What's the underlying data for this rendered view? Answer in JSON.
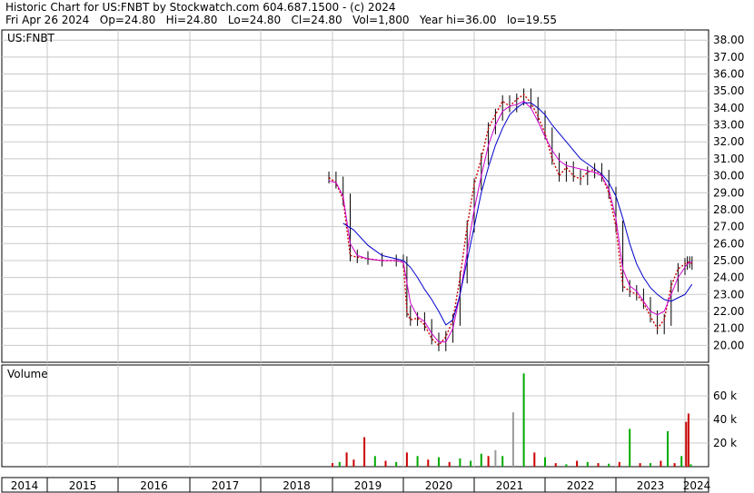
{
  "header": {
    "line1": "Historic Chart for US:FNBT by Stockwatch.com 604.687.1500 - (c) 2024",
    "line2": "Fri Apr 26 2024   Op=24.80   Hi=24.80   Lo=24.80   Cl=24.80   Vol=1,800   Year hi=36.00   lo=19.55"
  },
  "chart_data": {
    "type": "line",
    "symbol_label": "US:FNBT",
    "volume_label": "Volume",
    "price_axis": {
      "ticks": [
        "38.00",
        "37.00",
        "36.00",
        "35.00",
        "34.00",
        "33.00",
        "32.00",
        "31.00",
        "30.00",
        "29.00",
        "28.00",
        "27.00",
        "26.00",
        "25.00",
        "24.00",
        "23.00",
        "22.00",
        "21.00",
        "20.00"
      ],
      "min": 19.0,
      "max": 38.6
    },
    "volume_axis": {
      "ticks": [
        "60 k",
        "40 k",
        "20 k"
      ],
      "max": 80000
    },
    "years": [
      "2014",
      "2015",
      "2016",
      "2017",
      "2018",
      "2019",
      "2020",
      "2021",
      "2022",
      "2023",
      "2024"
    ],
    "colors": {
      "price_bars": "#000000",
      "close_dots": "#cc0000",
      "ma_short": "#cc00cc",
      "ma_long": "#0000cc",
      "vol_up": "#00aa00",
      "vol_down": "#cc0000",
      "vol_neutral": "#999999",
      "grid": "#c8c8c8"
    },
    "series": [
      {
        "name": "price",
        "x": [
          2018.95,
          2019.05,
          2019.15,
          2019.25,
          2019.35,
          2019.5,
          2019.7,
          2019.9,
          2020.0,
          2020.05,
          2020.1,
          2020.2,
          2020.3,
          2020.4,
          2020.5,
          2020.6,
          2020.7,
          2020.8,
          2020.9,
          2021.0,
          2021.1,
          2021.2,
          2021.3,
          2021.4,
          2021.5,
          2021.6,
          2021.7,
          2021.8,
          2021.9,
          2022.0,
          2022.1,
          2022.2,
          2022.3,
          2022.4,
          2022.5,
          2022.6,
          2022.7,
          2022.8,
          2022.9,
          2023.0,
          2023.1,
          2023.2,
          2023.3,
          2023.4,
          2023.5,
          2023.6,
          2023.7,
          2023.8,
          2023.9,
          2024.0,
          2024.1,
          2024.2,
          2024.3
        ],
        "y": [
          29.9,
          29.6,
          28.6,
          25.3,
          25.2,
          25.1,
          25.0,
          25.0,
          24.9,
          22.0,
          21.5,
          21.6,
          21.2,
          20.4,
          20.0,
          20.5,
          21.5,
          24.0,
          27.0,
          29.5,
          31.0,
          32.8,
          33.6,
          34.4,
          34.1,
          34.5,
          34.8,
          34.3,
          33.5,
          32.5,
          31.0,
          30.0,
          30.5,
          30.0,
          29.8,
          30.2,
          30.4,
          30.0,
          29.0,
          27.0,
          23.5,
          23.2,
          23.0,
          22.5,
          21.7,
          21.0,
          21.5,
          23.5,
          24.5,
          24.8,
          24.9,
          24.9,
          24.8
        ]
      },
      {
        "name": "",
        "x": [
          2018.95,
          2019.05,
          2019.15,
          2019.25,
          2019.35,
          2019.5,
          2019.7,
          2019.9,
          2020.0,
          2020.1,
          2020.2,
          2020.3,
          2020.4,
          2020.5,
          2020.6,
          2020.7,
          2020.8,
          2020.9,
          2021.0,
          2021.1,
          2021.2,
          2021.3,
          2021.4,
          2021.5,
          2021.6,
          2021.7,
          2021.8,
          2021.9,
          2022.0,
          2022.1,
          2022.2,
          2022.3,
          2022.4,
          2022.5,
          2022.6,
          2022.7,
          2022.8,
          2022.9,
          2023.0,
          2023.1,
          2023.2,
          2023.3,
          2023.4,
          2023.5,
          2023.6,
          2023.7,
          2023.8,
          2023.9,
          2024.0,
          2024.1,
          2024.2,
          2024.3
        ],
        "y": [
          29.7,
          29.6,
          28.8,
          26.0,
          25.3,
          25.1,
          25.0,
          25.0,
          24.9,
          22.5,
          21.7,
          21.4,
          20.7,
          20.2,
          20.2,
          21.0,
          23.0,
          25.5,
          28.0,
          30.0,
          31.8,
          33.0,
          33.8,
          34.1,
          34.2,
          34.4,
          34.0,
          33.2,
          32.3,
          31.5,
          30.9,
          30.6,
          30.5,
          30.4,
          30.3,
          30.2,
          30.0,
          29.2,
          27.5,
          24.5,
          23.5,
          23.2,
          22.6,
          22.0,
          21.8,
          22.0,
          23.0,
          24.0,
          24.6,
          24.8,
          24.9,
          24.9
        ]
      },
      {
        "name": "",
        "x": [
          2019.15,
          2019.3,
          2019.5,
          2019.7,
          2019.9,
          2020.0,
          2020.1,
          2020.2,
          2020.3,
          2020.4,
          2020.5,
          2020.6,
          2020.7,
          2020.8,
          2020.9,
          2021.0,
          2021.1,
          2021.2,
          2021.3,
          2021.4,
          2021.5,
          2021.6,
          2021.7,
          2021.8,
          2021.9,
          2022.0,
          2022.1,
          2022.2,
          2022.3,
          2022.4,
          2022.5,
          2022.6,
          2022.7,
          2022.8,
          2022.9,
          2023.0,
          2023.1,
          2023.2,
          2023.3,
          2023.4,
          2023.5,
          2023.6,
          2023.7,
          2023.8,
          2023.9,
          2024.0,
          2024.1,
          2024.2,
          2024.3
        ],
        "y": [
          27.2,
          26.8,
          25.9,
          25.3,
          25.1,
          25.0,
          24.6,
          24.0,
          23.3,
          22.7,
          22.0,
          21.2,
          21.5,
          23.0,
          25.0,
          27.0,
          29.0,
          30.5,
          31.8,
          32.8,
          33.6,
          34.0,
          34.3,
          34.3,
          34.0,
          33.6,
          33.0,
          32.5,
          32.0,
          31.5,
          31.0,
          30.7,
          30.4,
          30.1,
          29.6,
          28.8,
          27.5,
          26.0,
          24.8,
          24.0,
          23.4,
          23.0,
          22.7,
          22.6,
          22.8,
          23.0,
          23.2,
          23.4,
          23.6
        ]
      }
    ],
    "volume": {
      "x": [
        2019.0,
        2019.1,
        2019.2,
        2019.3,
        2019.45,
        2019.6,
        2019.75,
        2019.9,
        2020.05,
        2020.2,
        2020.35,
        2020.5,
        2020.65,
        2020.8,
        2020.95,
        2021.1,
        2021.2,
        2021.3,
        2021.4,
        2021.55,
        2021.7,
        2021.85,
        2022.0,
        2022.15,
        2022.3,
        2022.45,
        2022.6,
        2022.75,
        2022.9,
        2023.05,
        2023.2,
        2023.35,
        2023.5,
        2023.65,
        2023.75,
        2023.85,
        2023.95,
        2024.05,
        2024.15,
        2024.25
      ],
      "values": [
        3000,
        4000,
        12000,
        6000,
        25000,
        9000,
        5000,
        4000,
        12000,
        9000,
        6000,
        8000,
        4000,
        7000,
        5000,
        11000,
        9000,
        14000,
        9000,
        46000,
        79000,
        12000,
        8000,
        3000,
        2000,
        5000,
        4000,
        3000,
        2500,
        4000,
        32000,
        3000,
        3000,
        5000,
        30000,
        3000,
        9000,
        38000,
        45000,
        2000
      ],
      "direction": [
        "down",
        "up",
        "down",
        "down",
        "down",
        "up",
        "down",
        "up",
        "down",
        "up",
        "down",
        "up",
        "down",
        "up",
        "up",
        "up",
        "down",
        "neutral",
        "up",
        "neutral",
        "up",
        "down",
        "up",
        "down",
        "up",
        "down",
        "up",
        "down",
        "up",
        "down",
        "up",
        "down",
        "up",
        "down",
        "up",
        "down",
        "up",
        "down",
        "down",
        "up"
      ]
    }
  }
}
